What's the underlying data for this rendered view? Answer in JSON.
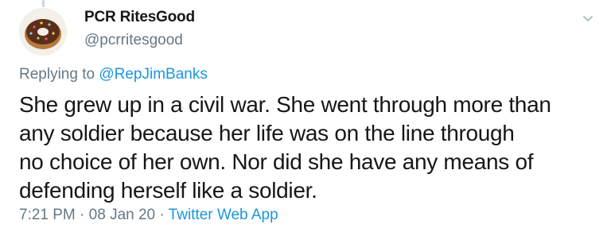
{
  "author": {
    "display_name": "PCR RitesGood",
    "handle": "@pcrritesgood",
    "avatar_icon": "donut-icon"
  },
  "reply": {
    "prefix": "Replying to ",
    "mention": "@RepJimBanks"
  },
  "body": {
    "lines": [
      "She grew up in a civil war. She went through more than",
      "any soldier because her life was on the line through",
      "no choice of her own. Nor did she have any means of",
      "defending herself like a soldier."
    ]
  },
  "meta": {
    "time": "7:21 PM",
    "separator": " · ",
    "date": "08 Jan 20",
    "source": "Twitter Web App"
  },
  "colors": {
    "text": "#14171a",
    "secondary": "#657786",
    "link": "#1b95e0",
    "background": "#ffffff"
  },
  "menu_icon": "chevron-down-icon"
}
